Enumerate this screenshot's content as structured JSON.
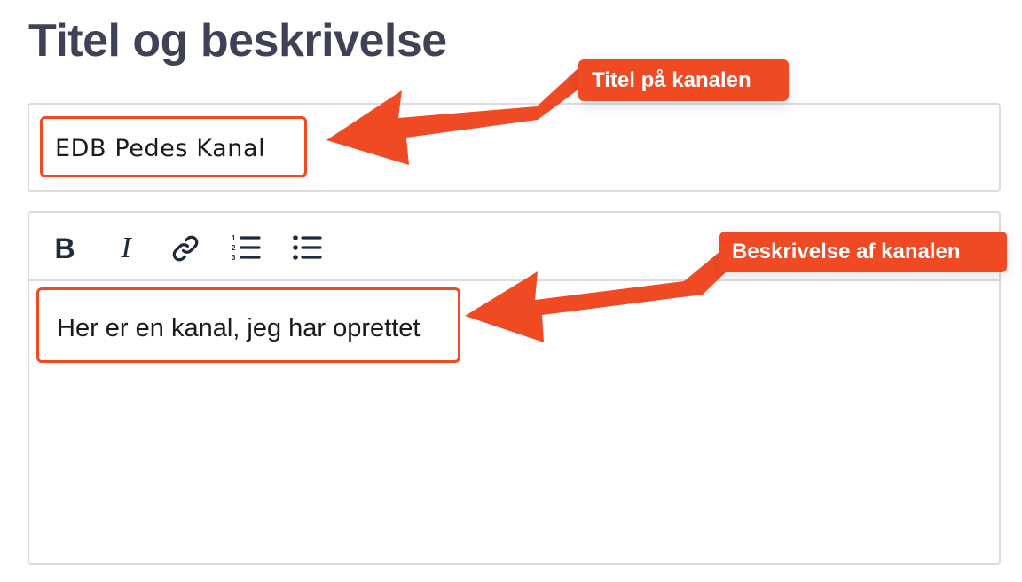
{
  "section": {
    "title": "Titel og beskrivelse"
  },
  "title_field": {
    "value": "EDB Pedes Kanal"
  },
  "description_editor": {
    "toolbar": {
      "bold_label": "B",
      "italic_label": "I",
      "link_icon": "link-icon",
      "ordered_list_icon": "ordered-list-icon",
      "bullet_list_icon": "bullet-list-icon"
    },
    "value": "Her er en kanal, jeg har oprettet"
  },
  "annotations": {
    "title_callout": "Titel på kanalen",
    "description_callout": "Beskrivelse af kanalen",
    "accent_color": "#f04a25"
  }
}
